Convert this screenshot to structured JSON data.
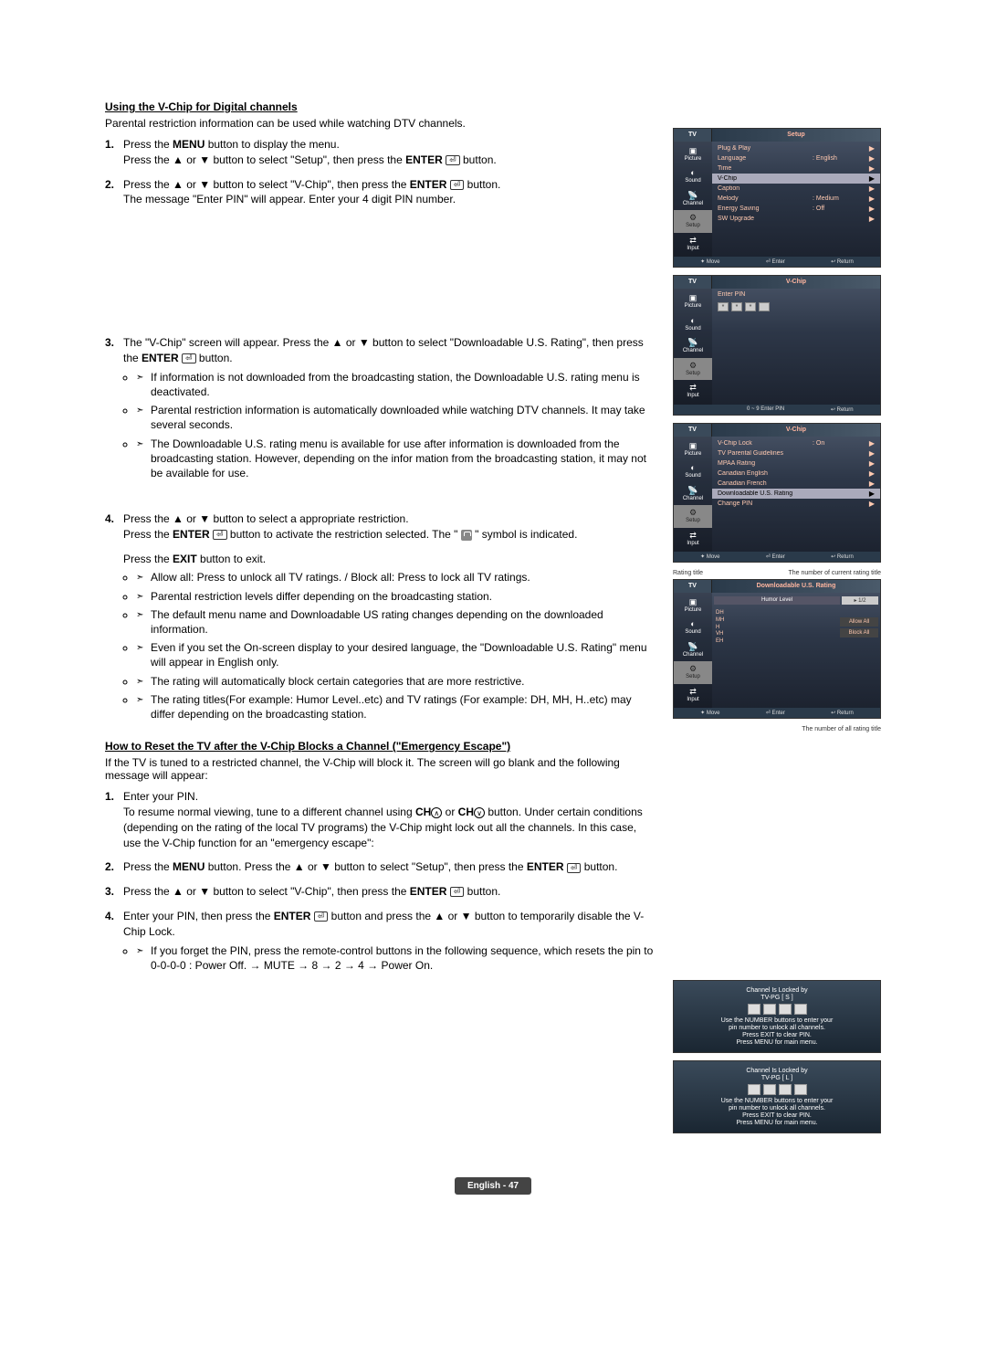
{
  "section1": {
    "heading": "Using the V-Chip for Digital channels",
    "intro": "Parental restriction information can be used while watching DTV channels.",
    "step1a": "Press the ",
    "step1a_bold": "MENU",
    "step1a_end": " button to display the menu.",
    "step1b": "Press the ▲ or ▼ button to select \"Setup\", then press the ",
    "step1b_bold": "ENTER",
    "step1b_end": " button.",
    "step2a": "Press the ▲ or ▼ button to select \"V-Chip\", then press the ",
    "step2a_bold": "ENTER",
    "step2a_end": " button.",
    "step2b": "The message \"Enter PIN\" will appear. Enter your 4 digit PIN number.",
    "step3a": "The \"V-Chip\" screen will appear. Press the ▲ or ▼ button to select \"Downloadable U.S. Rating\", then press the ",
    "step3a_bold": "ENTER",
    "step3a_end": " button.",
    "step3_sub1": "If information is not downloaded from the broadcasting station, the Downloadable U.S. rating menu is deactivated.",
    "step3_sub2": "Parental restriction information is automatically downloaded while watching DTV channels. It may take several seconds.",
    "step3_sub3": "The Downloadable U.S. rating menu is available for use after information is downloaded from the broadcasting station. However, depending on the infor mation from the broadcasting station, it may not be available for use.",
    "step4a": "Press the ▲ or ▼ button to select a appropriate restriction.",
    "step4b": "Press the ",
    "step4b_bold": "ENTER",
    "step4b_mid": " button to activate the restriction selected. The \" ",
    "step4b_end": " \" symbol is indicated.",
    "step4c": "Press the ",
    "step4c_bold": "EXIT",
    "step4c_end": " button to exit.",
    "step4_sub1": "Allow all: Press to unlock all TV ratings. / Block all: Press to lock all TV ratings.",
    "step4_sub2": "Parental restriction levels differ depending on the broadcasting station.",
    "step4_sub3": "The default menu name and Downloadable US rating changes depending on the downloaded information.",
    "step4_sub4": "Even if you set the On-screen display to your desired language, the \"Downloadable U.S. Rating\" menu will appear in English only.",
    "step4_sub5": "The rating will automatically block certain categories that are more restrictive.",
    "step4_sub6": "The rating titles(For example: Humor Level..etc) and TV ratings (For example: DH, MH, H..etc) may differ depending on the broadcasting station."
  },
  "section2": {
    "heading": "How to Reset the TV after the V-Chip Blocks a Channel (\"Emergency Escape\")",
    "intro": "If the TV is tuned to a restricted channel, the V-Chip will block it. The screen will go blank and the following message will appear:",
    "step1a": "Enter your PIN.",
    "step1b_pre": "To resume normal viewing, tune to a different channel using ",
    "step1b_ch1": "CH",
    "step1b_mid": " or ",
    "step1b_ch2": "CH",
    "step1b_post": " button. Under certain conditions (depending on the rating of the local TV programs) the V-Chip might lock out all the channels. In this case, use the V-Chip function for an \"emergency escape\":",
    "step2": "Press the ",
    "step2_bold": "MENU",
    "step2_mid": " button. Press the ▲ or ▼ button to select \"Setup\", then press the ",
    "step2_bold2": "ENTER",
    "step2_end": " button.",
    "step3": "Press the ▲ or ▼ button to select \"V-Chip\", then press the ",
    "step3_bold": "ENTER",
    "step3_end": " button.",
    "step4": "Enter your PIN, then press the ",
    "step4_bold": "ENTER",
    "step4_mid": " button and press the ▲ or ▼ button to temporarily disable the V-Chip Lock.",
    "step4_sub1": "If you forget the PIN, press the remote-control buttons in the following sequence, which resets the pin to 0-0-0-0 : Power Off. → MUTE → 8 → 2 → 4 → Power On."
  },
  "osd": {
    "tv": "TV",
    "setup_title": "Setup",
    "vchip_title": "V-Chip",
    "dl_title": "Downloadable U.S. Rating",
    "nav": {
      "picture": "Picture",
      "sound": "Sound",
      "channel": "Channel",
      "setup": "Setup",
      "input": "Input"
    },
    "setup_items": {
      "plug": "Plug & Play",
      "lang": "Language",
      "lang_v": ": English",
      "time": "Time",
      "vchip": "V-Chip",
      "caption": "Caption",
      "melody": "Melody",
      "melody_v": ": Medium",
      "energy": "Energy Saving",
      "energy_v": ": Off",
      "swup": "SW Upgrade"
    },
    "pin": {
      "enter": "Enter PIN",
      "foot_enter": "0 ~ 9 Enter PIN",
      "foot_return": "↩ Return"
    },
    "vchip_items": {
      "lock": "V-Chip Lock",
      "lock_v": ": On",
      "tvpg": "TV Parental Guidelines",
      "mpaa": "MPAA Rating",
      "cen": "Canadian English",
      "cfr": "Canadian French",
      "dl": "Downloadable U.S. Rating",
      "chpin": "Change PIN"
    },
    "foot": {
      "move": "✦ Move",
      "enter": "⏎ Enter",
      "return": "↩ Return"
    },
    "rating": {
      "rtitle_lbl": "Rating title",
      "num_current": "The number of current rating title",
      "num_all": "The number of all rating title",
      "humor": "Humor Level",
      "page": "▸ 1/2",
      "allow": "Allow All",
      "block": "Block All",
      "levels": [
        "DH",
        "MH",
        "H",
        "VH",
        "EH"
      ]
    }
  },
  "locked": {
    "hdr": "Channel Is Locked by",
    "tvpgs": "TV-PG [ S ]",
    "tvpgl": "TV-PG [ L ]",
    "l1": "Use the NUMBER buttons to enter your",
    "l2": "pin number to unlock all channels.",
    "l3": "Press EXIT to clear PIN.",
    "l4": "Press MENU for main menu."
  },
  "footer": "English - 47"
}
